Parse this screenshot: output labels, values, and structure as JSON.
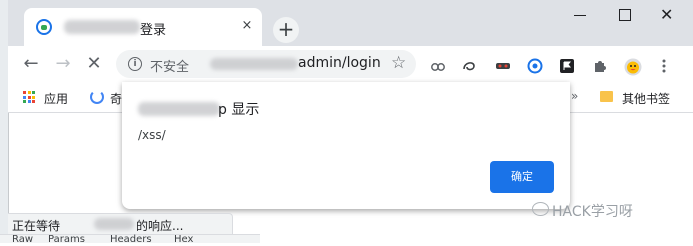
{
  "tab": {
    "title": "登录",
    "close": "×"
  },
  "new_tab": "+",
  "window": {
    "close": "✕"
  },
  "nav": {
    "back": "←",
    "forward": "→",
    "stop": "✕"
  },
  "omnibox": {
    "info": "i",
    "security": "不安全",
    "url_tail": "admin/login",
    "star": "☆"
  },
  "bookmarks": {
    "apps": "应用",
    "fav_partial": "奇",
    "more": "»",
    "other": "其他书签"
  },
  "dialog": {
    "title_suffix": "p 显示",
    "message": "/xss/",
    "ok": "确定"
  },
  "status": {
    "prefix": "正在等待",
    "suffix": "的响应..."
  },
  "devtools_tabs": [
    "Raw",
    "Params",
    "Headers",
    "Hex"
  ],
  "watermark": "HACK学习呀",
  "colors": {
    "accent": "#1a73e8",
    "titlebar": "#dee1e6"
  }
}
